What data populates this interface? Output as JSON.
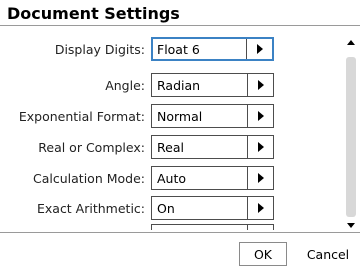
{
  "dialog": {
    "title": "Document Settings",
    "settings": [
      {
        "label": "Display Digits:",
        "value": "Float 6"
      },
      {
        "label": "Angle:",
        "value": "Radian"
      },
      {
        "label": "Exponential Format:",
        "value": "Normal"
      },
      {
        "label": "Real or Complex:",
        "value": "Real"
      },
      {
        "label": "Calculation Mode:",
        "value": "Auto"
      },
      {
        "label": "Exact Arithmetic:",
        "value": "On"
      },
      {
        "label": "",
        "value": ""
      }
    ],
    "buttons": {
      "ok": "OK",
      "cancel": "Cancel"
    },
    "colors": {
      "focus": "#3b82c4",
      "border": "#4d4d4d",
      "divider": "#9a9a9a"
    }
  }
}
